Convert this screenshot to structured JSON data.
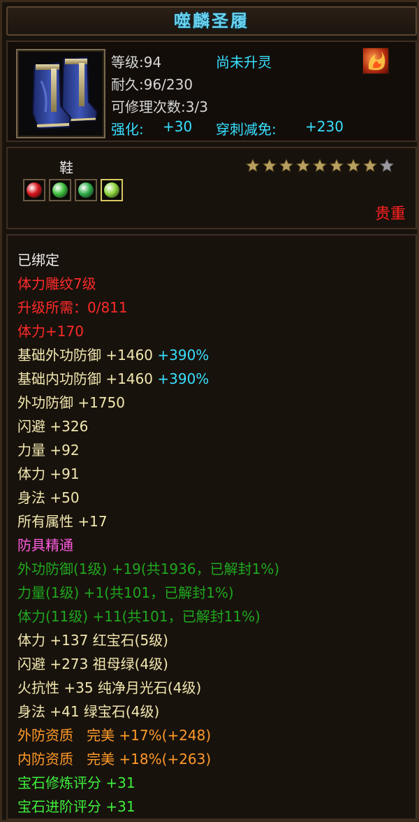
{
  "title": "噬麟圣履",
  "item": {
    "icon": "blue-boots-icon",
    "level_label": "等级:94",
    "spirit_status": "尚未升灵",
    "durability_label": "耐久:96/230",
    "repair_label": "可修理次数:3/3",
    "enhance_label": "强化:",
    "enhance_value": "+30",
    "pierce_label": "穿刺减免:",
    "pierce_value": "+230",
    "corner_icon": "flame-badge-icon"
  },
  "type": "鞋",
  "stars": {
    "filled": 8,
    "total": 9
  },
  "gems": [
    {
      "name": "red-gem-icon",
      "color": "#d4141a"
    },
    {
      "name": "green-gem-icon",
      "color": "#3cbf3c"
    },
    {
      "name": "jade-gem-icon",
      "color": "#2fae4a"
    },
    {
      "name": "moonlight-gem-icon",
      "color": "#8bd23a"
    }
  ],
  "rarity": "贵重",
  "details": {
    "bound": "已绑定",
    "engrave": "体力雕纹7级",
    "upgrade": "升级所需：0/811",
    "stamina_bonus": "体力+170",
    "base_outer_label": "基础外功防御 +1460",
    "base_outer_pct": "+390%",
    "base_inner_label": "基础内功防御 +1460",
    "base_inner_pct": "+390%",
    "outer_def": "外功防御 +1750",
    "dodge": "闪避 +326",
    "strength": "力量 +92",
    "stamina": "体力 +91",
    "agility": "身法 +50",
    "all_attr": "所有属性 +17",
    "mastery": "防具精通",
    "mastery_1": "外功防御(1级) +19(共1936，已解封1%)",
    "mastery_2": "力量(1级) +1(共101，已解封1%)",
    "mastery_3": "体力(11级) +11(共101，已解封11%)",
    "gem_1": "体力 +137 红宝石(5级)",
    "gem_2": "闪避 +273 祖母绿(4级)",
    "gem_3": "火抗性 +35 纯净月光石(4级)",
    "gem_4": "身法 +41 绿宝石(4级)",
    "quality_outer": "外防资质   完美 +17%(+248)",
    "quality_inner": "内防资质   完美 +18%(+263)",
    "gem_refine": "宝石修炼评分 +31",
    "gem_advance": "宝石进阶评分 +31"
  },
  "colors": {
    "title": "#69d3f0",
    "cyan": "#38e0ff",
    "red": "#ff2a2a",
    "pink": "#ff5ae0",
    "green": "#1fa81f",
    "orange": "#ff9a2a",
    "light_green": "#3ef03e"
  }
}
